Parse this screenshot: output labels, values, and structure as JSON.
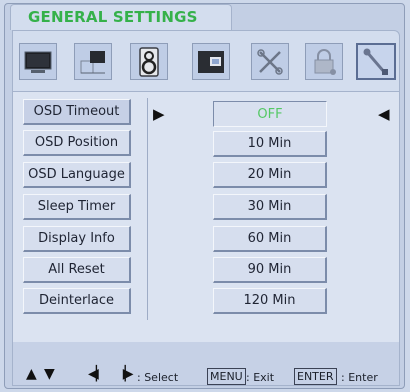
{
  "window": {
    "title": "GENERAL SETTINGS"
  },
  "icon_tabs": [
    {
      "name": "picture-icon"
    },
    {
      "name": "screen-position-icon"
    },
    {
      "name": "audio-icon"
    },
    {
      "name": "pip-icon"
    },
    {
      "name": "tools-icon"
    },
    {
      "name": "lock-icon"
    },
    {
      "name": "general-settings-icon",
      "active": true
    }
  ],
  "menu": {
    "items": [
      {
        "label": "OSD Timeout",
        "selected": true
      },
      {
        "label": "OSD Position"
      },
      {
        "label": "OSD Language"
      },
      {
        "label": "Sleep Timer"
      },
      {
        "label": "Display Info"
      },
      {
        "label": "All Reset"
      },
      {
        "label": "Deinterlace"
      }
    ]
  },
  "options": {
    "items": [
      {
        "label": "OFF",
        "current": true
      },
      {
        "label": "10 Min"
      },
      {
        "label": "20 Min"
      },
      {
        "label": "30 Min"
      },
      {
        "label": "60 Min"
      },
      {
        "label": "90 Min"
      },
      {
        "label": "120 Min"
      }
    ]
  },
  "footer": {
    "select_label": ": Select",
    "menu_key": "MENU",
    "exit_label": ": Exit",
    "enter_key": "ENTER",
    "enter_label": ": Enter"
  },
  "colors": {
    "title": "#35b14a",
    "current_option": "#55c866",
    "panel_bg": "#c3cfe4"
  }
}
